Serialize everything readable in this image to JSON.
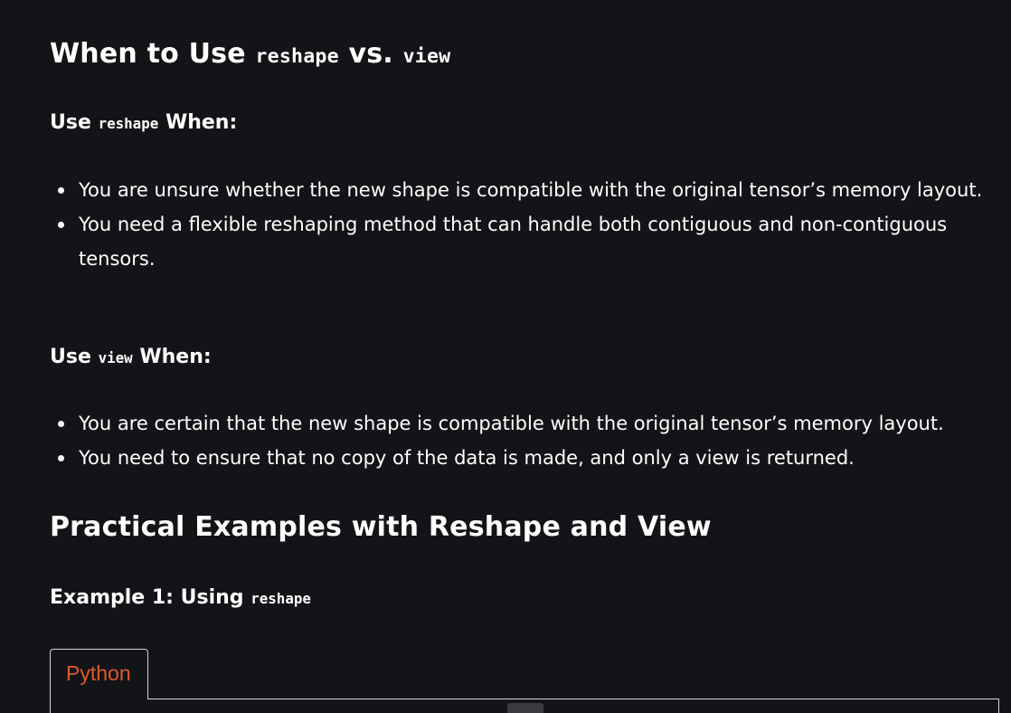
{
  "sections": {
    "when_heading": {
      "prefix": "When to Use",
      "code1": "reshape",
      "middle": "vs.",
      "code2": "view"
    },
    "reshape_sub": {
      "prefix": "Use",
      "code": "reshape",
      "suffix": "When:"
    },
    "reshape_items": [
      "You are unsure whether the new shape is compatible with the original tensor’s memory layout.",
      "You need a flexible reshaping method that can handle both contiguous and non-contiguous tensors."
    ],
    "view_sub": {
      "prefix": "Use",
      "code": "view",
      "suffix": "When:"
    },
    "view_items": [
      "You are certain that the new shape is compatible with the original tensor’s memory layout.",
      "You need to ensure that no copy of the data is made, and only a view is returned."
    ],
    "practical_heading": "Practical Examples with Reshape and View",
    "example1": {
      "prefix": "Example 1: Using",
      "code": "reshape"
    }
  },
  "code_tab": {
    "label": "Python"
  },
  "colors": {
    "background": "#131417",
    "text": "#ffffff",
    "tab_label": "#e05a2b",
    "border": "#d7d7d7"
  }
}
